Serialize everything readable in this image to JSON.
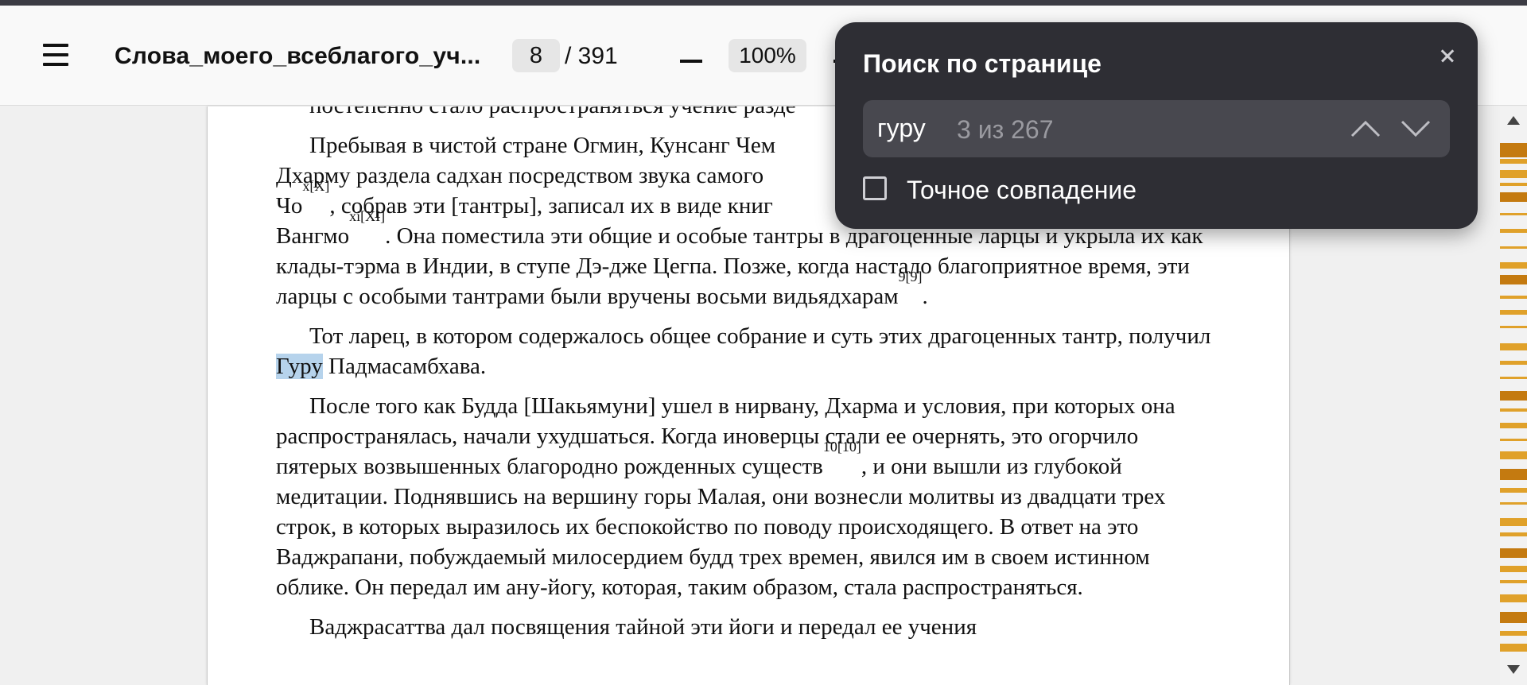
{
  "toolbar": {
    "doc_title": "Слова_моего_всеблагого_уч...",
    "page_current": "8",
    "page_total": "/ 391",
    "zoom": "100%"
  },
  "document": {
    "top_partial": "постепенно стало распространяться учение разде",
    "p1": [
      "Пребывая в чистой стране Огмин, Кунсанг Чем",
      "Дхарму раздела садхан посредством звука самого",
      "Чо",
      "x[X]",
      ", собрав эти [тантры], записал их в виде книг",
      "Вангмо",
      "xi[XI]",
      ". Она поместила эти общие и особые тантры в драгоценные ларцы и укрыла их как клады-тэрма в Индии, в ступе Дэ-дже Цегпа. Позже, когда настало благоприятное время, эти ларцы с особыми тантрами были вручены восьми видьядхарам",
      "9[9]",
      "."
    ],
    "p2": [
      "Тот ларец, в котором содержалось общее собрание и суть этих драгоценных тантр, получил ",
      "Гуру",
      " Падмасамбхава."
    ],
    "p3": [
      "После того как Будда [Шакьямуни] ушел в нирвану, Дхарма и условия, при которых она распространялась, начали ухудшаться. Когда иноверцы стали ее очернять, это огорчило пятерых возвышенных благородно рожденных существ",
      "10[10]",
      ", и они вышли из глубокой медитации. Поднявшись на вершину горы Малая, они вознесли молитвы из двадцати трех строк, в которых выразилось их беспокойство по поводу происходящего. В ответ на это Ваджрапани, побуждаемый милосердием будд трех времен, явился им в своем истинном облике. Он передал им ану-йогу, которая, таким образом, стала распространяться."
    ],
    "bottom_partial": "Ваджрасаттва дал посвящения тайной эти йоги и передал ее учения"
  },
  "search": {
    "title": "Поиск по странице",
    "query": "гуру",
    "count": "3 из 267",
    "exact_match_label": "Точное совпадение",
    "exact_match_checked": false
  },
  "colors": {
    "highlight": "#b6d3ec",
    "search_marks": "#e0a12a",
    "panel_bg": "#2e2e34"
  }
}
